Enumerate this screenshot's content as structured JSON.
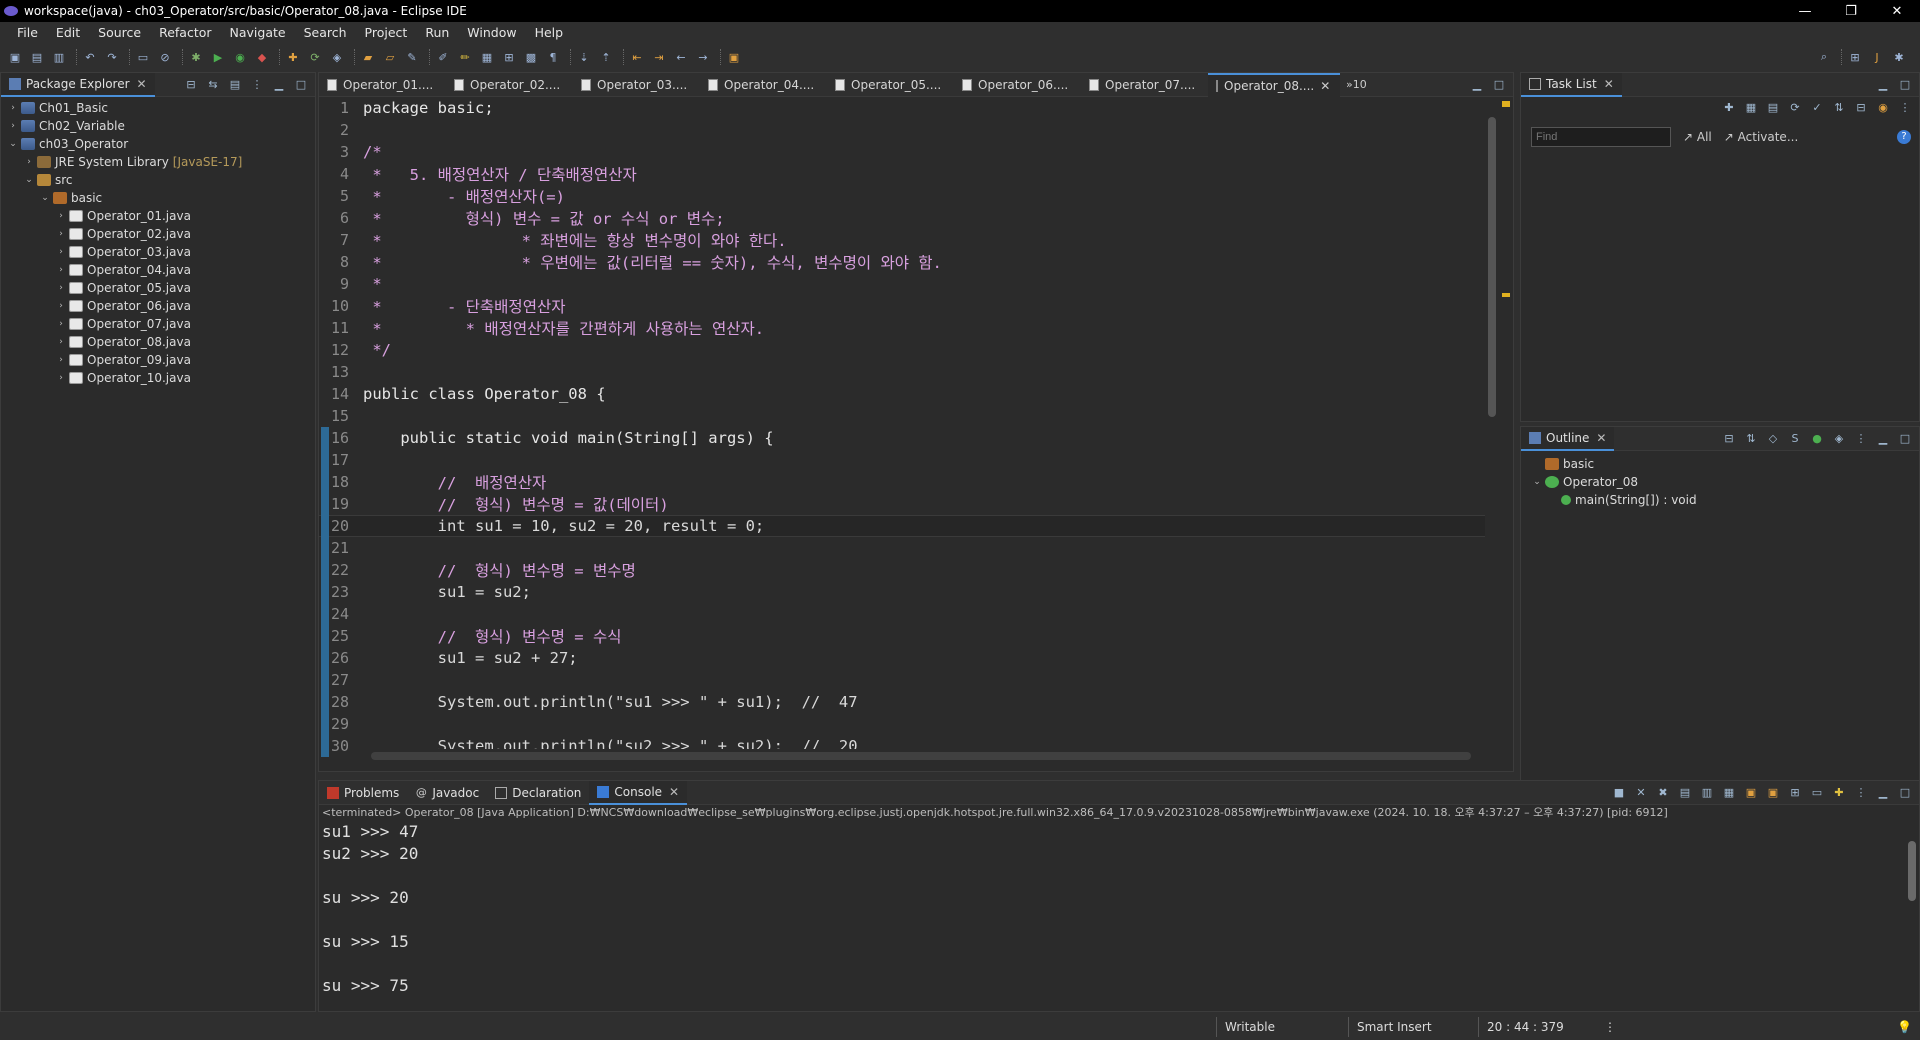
{
  "window": {
    "title": "workspace(java) - ch03_Operator/src/basic/Operator_08.java - Eclipse IDE",
    "controls": [
      "—",
      "❐",
      "✕"
    ]
  },
  "menu": [
    "File",
    "Edit",
    "Source",
    "Refactor",
    "Navigate",
    "Search",
    "Project",
    "Run",
    "Window",
    "Help"
  ],
  "package_explorer": {
    "title": "Package Explorer",
    "items": [
      {
        "label": "Ch01_Basic",
        "type": "project",
        "arrow": "›",
        "deco": ""
      },
      {
        "label": "Ch02_Variable",
        "type": "project",
        "arrow": "›",
        "deco": ""
      },
      {
        "label": "ch03_Operator",
        "type": "project",
        "arrow": "⌄",
        "deco": ""
      },
      {
        "label": "JRE System Library",
        "type": "library",
        "arrow": "›",
        "deco": "[JavaSE-17]"
      },
      {
        "label": "src",
        "type": "source-folder",
        "arrow": "⌄",
        "deco": ""
      },
      {
        "label": "basic",
        "type": "package",
        "arrow": "⌄",
        "deco": ""
      },
      {
        "label": "Operator_01.java",
        "type": "java-file",
        "arrow": "›",
        "deco": ""
      },
      {
        "label": "Operator_02.java",
        "type": "java-file",
        "arrow": "›",
        "deco": ""
      },
      {
        "label": "Operator_03.java",
        "type": "java-file",
        "arrow": "›",
        "deco": ""
      },
      {
        "label": "Operator_04.java",
        "type": "java-file",
        "arrow": "›",
        "deco": ""
      },
      {
        "label": "Operator_05.java",
        "type": "java-file",
        "arrow": "›",
        "deco": ""
      },
      {
        "label": "Operator_06.java",
        "type": "java-file",
        "arrow": "›",
        "deco": ""
      },
      {
        "label": "Operator_07.java",
        "type": "java-file",
        "arrow": "›",
        "deco": ""
      },
      {
        "label": "Operator_08.java",
        "type": "java-file",
        "arrow": "›",
        "deco": ""
      },
      {
        "label": "Operator_09.java",
        "type": "java-file",
        "arrow": "›",
        "deco": ""
      },
      {
        "label": "Operator_10.java",
        "type": "java-file",
        "arrow": "›",
        "deco": ""
      }
    ]
  },
  "editor": {
    "tabs": [
      "Operator_01....",
      "Operator_02....",
      "Operator_03....",
      "Operator_04....",
      "Operator_05....",
      "Operator_06....",
      "Operator_07....",
      "Operator_08...."
    ],
    "active_tab": 7,
    "more_tabs": "»10",
    "lines": [
      {
        "n": "1",
        "text": "package basic;"
      },
      {
        "n": "2",
        "text": ""
      },
      {
        "n": "3",
        "text": "/*"
      },
      {
        "n": "4",
        "text": " *   5. 배정연산자 / 단축배정연산자"
      },
      {
        "n": "5",
        "text": " *       - 배정연산자(=)"
      },
      {
        "n": "6",
        "text": " *         형식) 변수 = 값 or 수식 or 변수;"
      },
      {
        "n": "7",
        "text": " *               * 좌변에는 항상 변수명이 와야 한다."
      },
      {
        "n": "8",
        "text": " *               * 우변에는 값(리터럴 == 숫자), 수식, 변수명이 와야 함."
      },
      {
        "n": "9",
        "text": " *"
      },
      {
        "n": "10",
        "text": " *       - 단축배정연산자"
      },
      {
        "n": "11",
        "text": " *         * 배정연산자를 간편하게 사용하는 연산자."
      },
      {
        "n": "12",
        "text": " */"
      },
      {
        "n": "13",
        "text": ""
      },
      {
        "n": "14",
        "text": "public class Operator_08 {"
      },
      {
        "n": "15",
        "text": ""
      },
      {
        "n": "16",
        "text": "    public static void main(String[] args) {"
      },
      {
        "n": "17",
        "text": ""
      },
      {
        "n": "18",
        "text": "        //  배정연산자"
      },
      {
        "n": "19",
        "text": "        //  형식) 변수명 = 값(데이터)"
      },
      {
        "n": "20",
        "text": "        int su1 = 10, su2 = 20, result = 0;"
      },
      {
        "n": "21",
        "text": ""
      },
      {
        "n": "22",
        "text": "        //  형식) 변수명 = 변수명"
      },
      {
        "n": "23",
        "text": "        su1 = su2;"
      },
      {
        "n": "24",
        "text": ""
      },
      {
        "n": "25",
        "text": "        //  형식) 변수명 = 수식"
      },
      {
        "n": "26",
        "text": "        su1 = su2 + 27;"
      },
      {
        "n": "27",
        "text": ""
      },
      {
        "n": "28",
        "text": "        System.out.println(\"su1 >>> \" + su1);  //  47"
      },
      {
        "n": "29",
        "text": ""
      },
      {
        "n": "30",
        "text": "        System.out.println(\"su2 >>> \" + su2);  //  20"
      }
    ],
    "current_line": 20,
    "colors": {
      "keyword": "#cc6c1d",
      "comment": "#d8a0df",
      "string": "#17c6a3",
      "number": "#6897bb",
      "type": "#1290c3",
      "field": "#66e1f8"
    }
  },
  "task_list": {
    "title": "Task List",
    "find_placeholder": "Find",
    "all_label": "All",
    "activate_label": "Activate..."
  },
  "outline": {
    "title": "Outline",
    "items": [
      {
        "label": "basic",
        "indent": 0,
        "arrow": ""
      },
      {
        "label": "Operator_08",
        "indent": 0,
        "arrow": "⌄"
      },
      {
        "label": "main(String[]) : void",
        "indent": 1,
        "arrow": ""
      }
    ]
  },
  "console": {
    "tabs": [
      "Problems",
      "Javadoc",
      "Declaration",
      "Console"
    ],
    "active_tab": 3,
    "description": "<terminated> Operator_08 [Java Application] D:₩NCS₩download₩eclipse_se₩plugins₩org.eclipse.justj.openjdk.hotspot.jre.full.win32.x86_64_17.0.9.v20231028-0858₩jre₩bin₩javaw.exe  (2024. 10. 18. 오후 4:37:27 – 오후 4:37:27) [pid: 6912]",
    "output": [
      "su1 >>> 47",
      "su2 >>> 20",
      "",
      "su >>> 20",
      "",
      "su >>> 15",
      "",
      "su >>> 75"
    ]
  },
  "status": {
    "writable": "Writable",
    "insert_mode": "Smart Insert",
    "position": "20 : 44 : 379"
  }
}
